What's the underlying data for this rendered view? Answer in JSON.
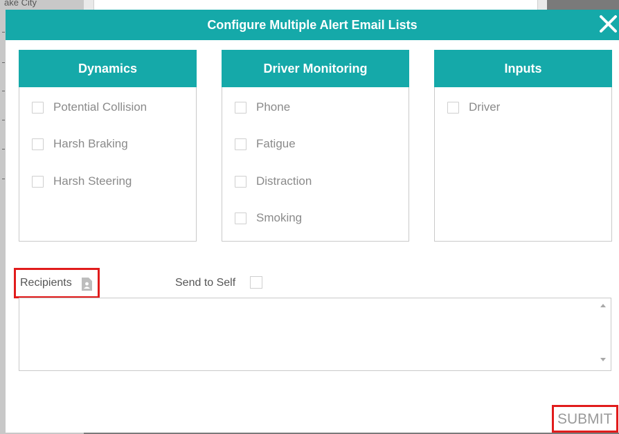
{
  "background": {
    "sidebar_text": "ake City"
  },
  "modal": {
    "title": "Configure Multiple Alert Email Lists",
    "close_icon": "close-icon",
    "header_color": "#15a9a9"
  },
  "panels": [
    {
      "title": "Dynamics",
      "options": [
        "Potential Collision",
        "Harsh Braking",
        "Harsh Steering"
      ]
    },
    {
      "title": "Driver Monitoring",
      "options": [
        "Phone",
        "Fatigue",
        "Distraction",
        "Smoking"
      ]
    },
    {
      "title": "Inputs",
      "options": [
        "Driver"
      ]
    }
  ],
  "recipients": {
    "label": "Recipients",
    "icon": "contact-book-icon",
    "value": ""
  },
  "send_to_self": {
    "label": "Send to Self",
    "checked": false
  },
  "submit": {
    "label": "SUBMIT"
  },
  "highlight_color": "#e11b1b"
}
